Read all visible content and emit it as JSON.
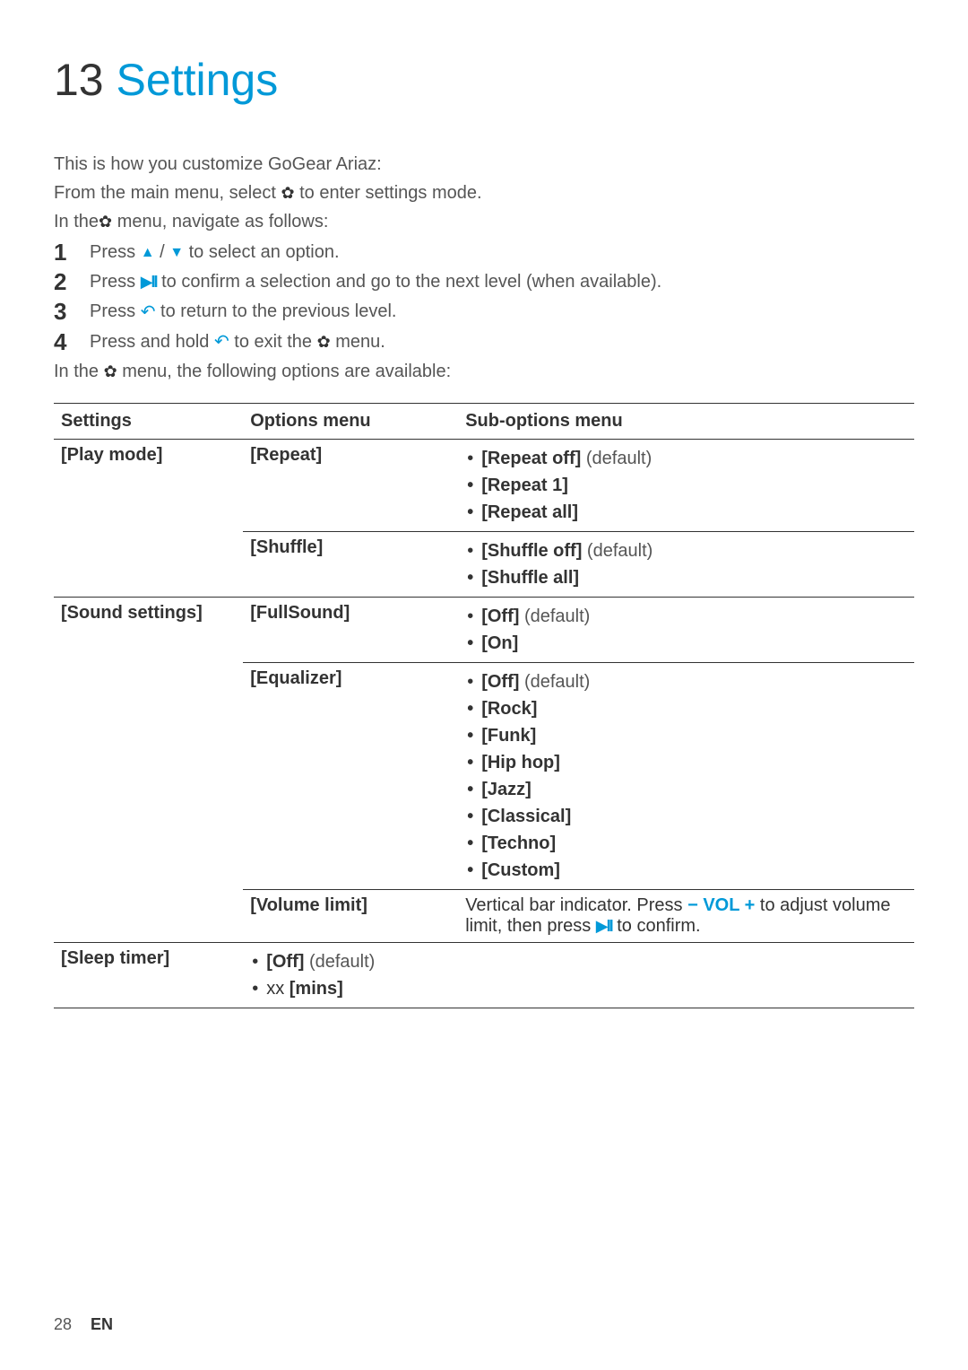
{
  "title": {
    "number": "13",
    "text": "Settings"
  },
  "intro": {
    "line1": "This is how you customize GoGear Ariaz:",
    "line2_pre": "From the main menu, select ",
    "line2_post": " to enter settings mode.",
    "line3_pre": "In the",
    "line3_post": " menu, navigate as follows:"
  },
  "steps": [
    {
      "num": "1",
      "pre": "Press ",
      "post": " to select an option.",
      "mid_icons": "updown"
    },
    {
      "num": "2",
      "pre": "Press ",
      "post": "to confirm a selection and go to the next level (when available).",
      "mid_icons": "playpause"
    },
    {
      "num": "3",
      "pre": "Press ",
      "post": " to return to the previous level.",
      "mid_icons": "back"
    },
    {
      "num": "4",
      "pre": "Press and hold ",
      "mid_icons": "back_gear",
      "post": " menu."
    }
  ],
  "outro": {
    "pre": "In the ",
    "post": " menu, the following options are available:"
  },
  "table": {
    "headers": [
      "Settings",
      "Options menu",
      "Sub-options menu"
    ],
    "rows": [
      {
        "setting": "[Play mode]",
        "options": [
          {
            "name": "[Repeat]",
            "subs": [
              {
                "label": "[Repeat off]",
                "default": true
              },
              {
                "label": "[Repeat 1]"
              },
              {
                "label": "[Repeat all]"
              }
            ]
          },
          {
            "name": "[Shuffle]",
            "subs": [
              {
                "label": "[Shuffle off]",
                "default": true
              },
              {
                "label": "[Shuffle all]"
              }
            ]
          }
        ]
      },
      {
        "setting": "[Sound settings]",
        "options": [
          {
            "name": "[FullSound]",
            "subs": [
              {
                "label": "[Off]",
                "default": true
              },
              {
                "label": "[On]"
              }
            ]
          },
          {
            "name": "[Equalizer]",
            "subs": [
              {
                "label": "[Off]",
                "default": true
              },
              {
                "label": "[Rock]"
              },
              {
                "label": "[Funk]"
              },
              {
                "label": "[Hip hop]"
              },
              {
                "label": "[Jazz]"
              },
              {
                "label": "[Classical]"
              },
              {
                "label": "[Techno]"
              },
              {
                "label": "[Custom]"
              }
            ]
          },
          {
            "name": "[Volume limit]",
            "vol_text": {
              "pre": "Vertical bar indicator. Press ",
              "minus": "−",
              "vol": " VOL ",
              "plus": "+",
              "mid": " to adjust volume limit, then press ",
              "post": "to confirm."
            }
          }
        ]
      },
      {
        "setting": "[Sleep timer]",
        "options_inline": [
          {
            "label": "[Off]",
            "default": true
          },
          {
            "label_pre": "xx ",
            "label": "[mins]"
          }
        ]
      }
    ]
  },
  "footer": {
    "page": "28",
    "lang": "EN"
  },
  "text": {
    "default": " (default)",
    "step4_mid": " to exit the "
  }
}
